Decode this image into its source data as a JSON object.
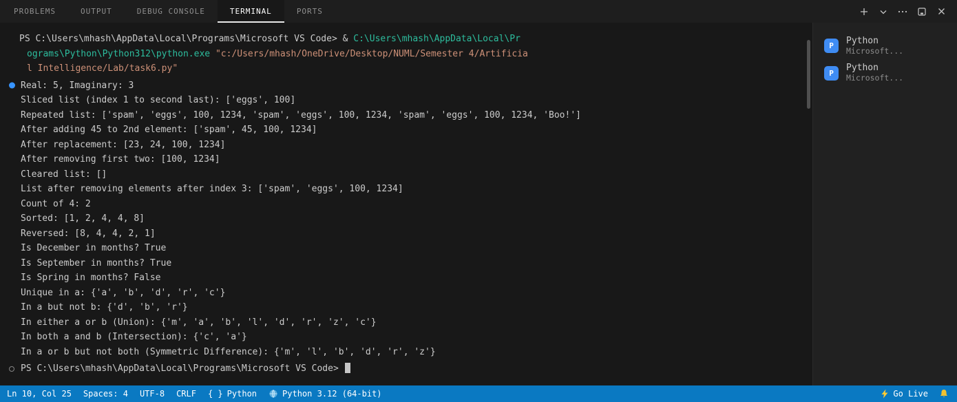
{
  "panel_tabs": [
    {
      "id": "problems",
      "label": "PROBLEMS",
      "active": false
    },
    {
      "id": "output",
      "label": "OUTPUT",
      "active": false
    },
    {
      "id": "debug-console",
      "label": "DEBUG CONSOLE",
      "active": false
    },
    {
      "id": "terminal",
      "label": "TERMINAL",
      "active": true
    },
    {
      "id": "ports",
      "label": "PORTS",
      "active": false
    }
  ],
  "panel_action_icons": [
    "plus-icon",
    "chevron-down-icon",
    "ellipsis-icon",
    "panel-icon",
    "close-icon"
  ],
  "colors": {
    "status_bar": "#0a79c2",
    "terminal_bg": "#181818",
    "path_text": "#2dbd9e",
    "string_text": "#ce9178",
    "command_decoration": "#3794ff",
    "python_icon_bg": "#3f8cf3"
  },
  "terminal": {
    "lines": [
      {
        "kind": "first",
        "segments": [
          {
            "text": "PS C:\\Users\\mhash\\AppData\\Local\\Programs\\Microsoft VS Code> & ",
            "color": "fg"
          },
          {
            "text": "C:\\Users\\mhash\\AppData\\Local\\Pr",
            "color": "path"
          }
        ]
      },
      {
        "kind": "wrap",
        "segments": [
          {
            "text": "ograms\\Python\\Python312\\python.exe ",
            "color": "path"
          },
          {
            "text": "\"c:/Users/mhash/OneDrive/Desktop/NUML/Semester 4/Artificia",
            "color": "str"
          }
        ]
      },
      {
        "kind": "wrap",
        "segments": [
          {
            "text": "l Intelligence/Lab/task6.py\"",
            "color": "str"
          }
        ]
      },
      {
        "kind": "out",
        "deco": "blue",
        "segments": [
          {
            "text": "Real: 5, Imaginary: 3",
            "color": "fg"
          }
        ]
      },
      {
        "kind": "out",
        "segments": [
          {
            "text": "Sliced list (index 1 to second last): ['eggs', 100]",
            "color": "fg"
          }
        ]
      },
      {
        "kind": "out",
        "segments": [
          {
            "text": "Repeated list: ['spam', 'eggs', 100, 1234, 'spam', 'eggs', 100, 1234, 'spam', 'eggs', 100, 1234, 'Boo!']",
            "color": "fg"
          }
        ]
      },
      {
        "kind": "out",
        "segments": [
          {
            "text": "After adding 45 to 2nd element: ['spam', 45, 100, 1234]",
            "color": "fg"
          }
        ]
      },
      {
        "kind": "out",
        "segments": [
          {
            "text": "After replacement: [23, 24, 100, 1234]",
            "color": "fg"
          }
        ]
      },
      {
        "kind": "out",
        "segments": [
          {
            "text": "After removing first two: [100, 1234]",
            "color": "fg"
          }
        ]
      },
      {
        "kind": "out",
        "segments": [
          {
            "text": "Cleared list: []",
            "color": "fg"
          }
        ]
      },
      {
        "kind": "out",
        "segments": [
          {
            "text": "List after removing elements after index 3: ['spam', 'eggs', 100, 1234]",
            "color": "fg"
          }
        ]
      },
      {
        "kind": "out",
        "segments": [
          {
            "text": "Count of 4: 2",
            "color": "fg"
          }
        ]
      },
      {
        "kind": "out",
        "segments": [
          {
            "text": "Sorted: [1, 2, 4, 4, 8]",
            "color": "fg"
          }
        ]
      },
      {
        "kind": "out",
        "segments": [
          {
            "text": "Reversed: [8, 4, 4, 2, 1]",
            "color": "fg"
          }
        ]
      },
      {
        "kind": "out",
        "segments": [
          {
            "text": "Is December in months? True",
            "color": "fg"
          }
        ]
      },
      {
        "kind": "out",
        "segments": [
          {
            "text": "Is September in months? True",
            "color": "fg"
          }
        ]
      },
      {
        "kind": "out",
        "segments": [
          {
            "text": "Is Spring in months? False",
            "color": "fg"
          }
        ]
      },
      {
        "kind": "out",
        "segments": [
          {
            "text": "Unique in a: {'a', 'b', 'd', 'r', 'c'}",
            "color": "fg"
          }
        ]
      },
      {
        "kind": "out",
        "segments": [
          {
            "text": "In a but not b: {'d', 'b', 'r'}",
            "color": "fg"
          }
        ]
      },
      {
        "kind": "out",
        "segments": [
          {
            "text": "In either a or b (Union): {'m', 'a', 'b', 'l', 'd', 'r', 'z', 'c'}",
            "color": "fg"
          }
        ]
      },
      {
        "kind": "out",
        "segments": [
          {
            "text": "In both a and b (Intersection): {'c', 'a'}",
            "color": "fg"
          }
        ]
      },
      {
        "kind": "out",
        "segments": [
          {
            "text": "In a or b but not both (Symmetric Difference): {'m', 'l', 'b', 'd', 'r', 'z'}",
            "color": "fg"
          }
        ]
      },
      {
        "kind": "prompt",
        "deco": "circle",
        "cursor": true,
        "segments": [
          {
            "text": "PS C:\\Users\\mhash\\AppData\\Local\\Programs\\Microsoft VS Code> ",
            "color": "fg"
          }
        ]
      }
    ]
  },
  "terminal_list": [
    {
      "name": "Python",
      "detail": "Microsoft...",
      "icon_letter": "P"
    },
    {
      "name": "Python",
      "detail": "Microsoft...",
      "icon_letter": "P"
    }
  ],
  "status_bar": {
    "line_col": "Ln 10, Col 25",
    "spaces": "Spaces: 4",
    "encoding": "UTF-8",
    "eol": "CRLF",
    "braces": "{ }",
    "language": "Python",
    "interpreter": "Python 3.12 (64-bit)",
    "go_live": "Go Live"
  }
}
